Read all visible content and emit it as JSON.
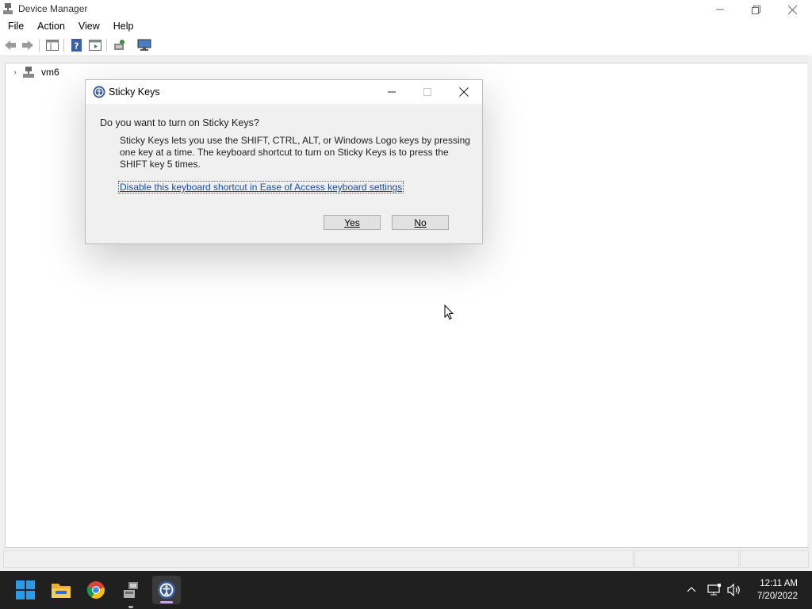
{
  "window": {
    "title": "Device Manager",
    "menu": [
      "File",
      "Action",
      "View",
      "Help"
    ],
    "controls": {
      "minimize": "minimize-icon",
      "restore": "restore-icon",
      "close": "close-icon"
    }
  },
  "toolbar": {
    "icons": [
      "back-arrow-icon",
      "forward-arrow-icon",
      "show-hide-console-tree-icon",
      "help-icon",
      "properties-icon",
      "scan-hardware-icon",
      "monitor-icon"
    ]
  },
  "tree": {
    "root_label": "vm6"
  },
  "dialog": {
    "title": "Sticky Keys",
    "question": "Do you want to turn on Sticky Keys?",
    "description": "Sticky Keys lets you use the SHIFT, CTRL, ALT, or Windows Logo keys by pressing one key at a time. The keyboard shortcut to turn on Sticky Keys is to press the SHIFT key 5 times.",
    "link": "Disable this keyboard shortcut in Ease of Access keyboard settings",
    "yes_label": "Yes",
    "no_label": "No"
  },
  "taskbar": {
    "apps": [
      "start-icon",
      "file-explorer-icon",
      "chrome-icon",
      "device-manager-icon",
      "ease-of-access-icon"
    ],
    "tray_icons": [
      "chevron-up-icon",
      "network-icon",
      "volume-icon"
    ],
    "time": "12:11 AM",
    "date": "7/20/2022"
  },
  "colors": {
    "accent": "#0067c0",
    "link": "#1a4fa3",
    "taskbar": "#202020"
  }
}
